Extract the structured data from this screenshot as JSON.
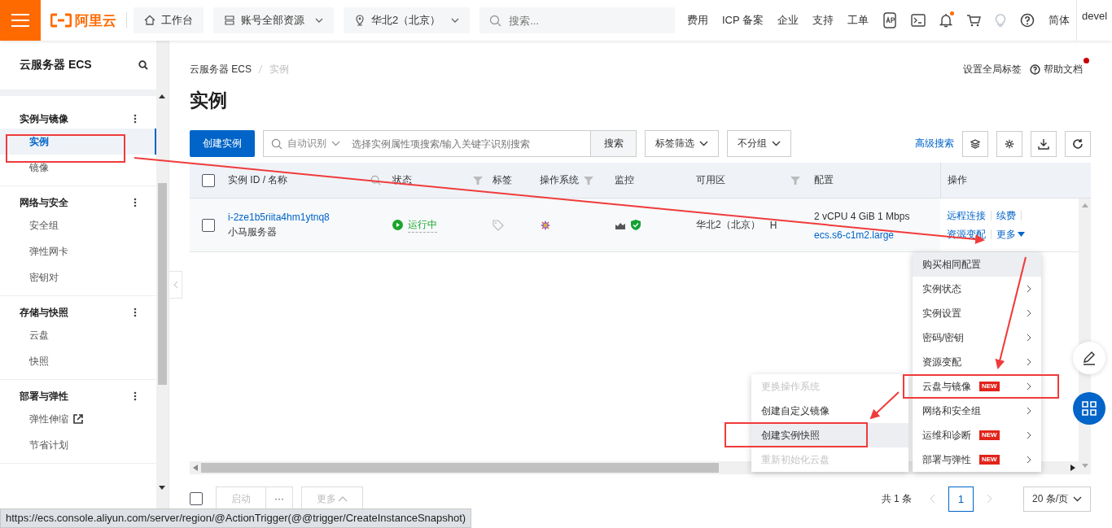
{
  "topbar": {
    "logo": "阿里云",
    "workbench": "工作台",
    "resources": "账号全部资源",
    "region": "华北2（北京）",
    "search": {
      "placeholder": "搜索..."
    },
    "links": [
      "费用",
      "ICP 备案",
      "企业",
      "支持",
      "工单"
    ],
    "has_notification": true,
    "language": "简体",
    "user": "devel"
  },
  "sidebar": {
    "title": "云服务器 ECS",
    "groups": [
      {
        "title": "实例与镜像",
        "items": [
          {
            "label": "实例",
            "selected": true,
            "external": false
          },
          {
            "label": "镜像",
            "selected": false,
            "external": false
          }
        ]
      },
      {
        "title": "网络与安全",
        "items": [
          {
            "label": "安全组",
            "selected": false,
            "external": false
          },
          {
            "label": "弹性网卡",
            "selected": false,
            "external": false
          },
          {
            "label": "密钥对",
            "selected": false,
            "external": false
          }
        ]
      },
      {
        "title": "存储与快照",
        "items": [
          {
            "label": "云盘",
            "selected": false,
            "external": false
          },
          {
            "label": "快照",
            "selected": false,
            "external": false
          }
        ]
      },
      {
        "title": "部署与弹性",
        "items": [
          {
            "label": "弹性伸缩",
            "selected": false,
            "external": true
          },
          {
            "label": "节省计划",
            "selected": false,
            "external": false
          }
        ]
      }
    ]
  },
  "breadcrumb": [
    "云服务器 ECS",
    "实例"
  ],
  "header_links": [
    {
      "label": "设置全局标签",
      "kind": "plain"
    },
    {
      "label": "帮助文档",
      "kind": "help"
    }
  ],
  "page_title": "实例",
  "toolbar": {
    "create_button": "创建实例",
    "search_mode": "自动识别",
    "search": {
      "placeholder": "选择实例属性项搜索/输入关键字识别搜索"
    },
    "search_button": "搜索",
    "tag_filter": "标签筛选",
    "group": "不分组",
    "advanced_search": "高级搜索"
  },
  "table": {
    "all_checked": false,
    "columns": [
      {
        "label": "实例 ID / 名称",
        "kind": "search"
      },
      {
        "label": "状态",
        "kind": "filter"
      },
      {
        "label": "标签",
        "kind": "plain"
      },
      {
        "label": "操作系统",
        "kind": "filter"
      },
      {
        "label": "监控",
        "kind": "plain"
      },
      {
        "label": "可用区",
        "kind": "filter"
      },
      {
        "label": "配置",
        "kind": "plain"
      },
      {
        "label": "操作",
        "kind": "plain"
      }
    ],
    "rows": [
      {
        "checked": false,
        "id": "i-2ze1b5riita4hm1ytnq8",
        "name": "小马服务器",
        "status": "运行中",
        "zone": "华北2（北京）",
        "zone_suffix": "H",
        "config": "2 vCPU 4 GiB 1 Mbps",
        "spec": "ecs.s6-c1m2.large",
        "actions": [
          "远程连接",
          "续费",
          "资源变配",
          "更多"
        ]
      }
    ]
  },
  "more_menu": [
    {
      "label": "购买相同配置",
      "selected": true,
      "submenu": false
    },
    {
      "label": "实例状态",
      "selected": false,
      "submenu": true
    },
    {
      "label": "实例设置",
      "selected": false,
      "submenu": true
    },
    {
      "label": "密码/密钥",
      "selected": false,
      "submenu": true
    },
    {
      "label": "资源变配",
      "selected": false,
      "submenu": true
    },
    {
      "label": "云盘与镜像",
      "selected": false,
      "submenu": true,
      "badge": "NEW"
    },
    {
      "label": "网络和安全组",
      "selected": false,
      "submenu": true
    },
    {
      "label": "运维和诊断",
      "selected": false,
      "submenu": true,
      "badge": "NEW"
    },
    {
      "label": "部署与弹性",
      "selected": false,
      "submenu": true,
      "badge": "NEW"
    }
  ],
  "submenu": [
    {
      "label": "更换操作系统",
      "disabled": true,
      "selected": false
    },
    {
      "label": "创建自定义镜像",
      "disabled": false,
      "selected": false
    },
    {
      "label": "创建实例快照",
      "disabled": false,
      "selected": true
    },
    {
      "label": "重新初始化云盘",
      "disabled": true,
      "selected": false
    }
  ],
  "footer": {
    "checked": false,
    "start": "启动",
    "ellipsis": "···",
    "more": "更多"
  },
  "pagination": {
    "total": "共 1 条",
    "pages": [
      {
        "label": "1",
        "selected": true
      }
    ],
    "page_size": "20 条/页"
  },
  "status_url": "https://ecs.console.aliyun.com/server/region/@ActionTrigger(@@trigger/CreateInstanceSnapshot)"
}
